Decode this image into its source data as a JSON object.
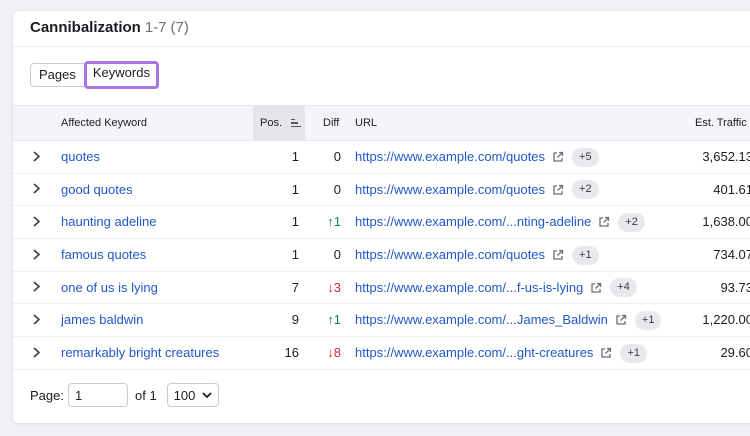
{
  "header": {
    "title": "Cannibalization",
    "range": "1-7",
    "count": "(7)"
  },
  "tabs": [
    {
      "label": "Pages",
      "active": false
    },
    {
      "label": "Keywords",
      "active": true
    }
  ],
  "columns": {
    "keyword": "Affected Keyword",
    "pos": "Pos.",
    "diff": "Diff",
    "url": "URL",
    "traffic": "Est. Traffic"
  },
  "rows": [
    {
      "keyword": "quotes",
      "pos": "1",
      "diff": "0",
      "diff_dir": "none",
      "url": "https://www.example.com/quotes",
      "badge": "+5",
      "traffic": "3,652.13"
    },
    {
      "keyword": "good quotes",
      "pos": "1",
      "diff": "0",
      "diff_dir": "none",
      "url": "https://www.example.com/quotes",
      "badge": "+2",
      "traffic": "401.61"
    },
    {
      "keyword": "haunting adeline",
      "pos": "1",
      "diff": "↑1",
      "diff_dir": "up",
      "url": "https://www.example.com/...nting-adeline",
      "badge": "+2",
      "traffic": "1,638.00"
    },
    {
      "keyword": "famous quotes",
      "pos": "1",
      "diff": "0",
      "diff_dir": "none",
      "url": "https://www.example.com/quotes",
      "badge": "+1",
      "traffic": "734.07"
    },
    {
      "keyword": "one of us is lying",
      "pos": "7",
      "diff": "↓3",
      "diff_dir": "down",
      "url": "https://www.example.com/...f-us-is-lying",
      "badge": "+4",
      "traffic": "93.73"
    },
    {
      "keyword": "james baldwin",
      "pos": "9",
      "diff": "↑1",
      "diff_dir": "up",
      "url": "https://www.example.com/...James_Baldwin",
      "badge": "+1",
      "traffic": "1,220.00"
    },
    {
      "keyword": "remarkably bright creatures",
      "pos": "16",
      "diff": "↓8",
      "diff_dir": "down",
      "url": "https://www.example.com/...ght-creatures",
      "badge": "+1",
      "traffic": "29.60"
    }
  ],
  "pager": {
    "label": "Page:",
    "current": "1",
    "of_label": "of 1",
    "page_size": "100"
  },
  "colors": {
    "accent": "#a875e6",
    "link": "#2058c9",
    "up": "#0f8a4a",
    "down": "#d3292f"
  },
  "icons": {
    "expand": "chevron-right-icon",
    "external": "external-link-icon",
    "sort": "sort-descending-icon",
    "dropdown": "chevron-down-icon"
  }
}
